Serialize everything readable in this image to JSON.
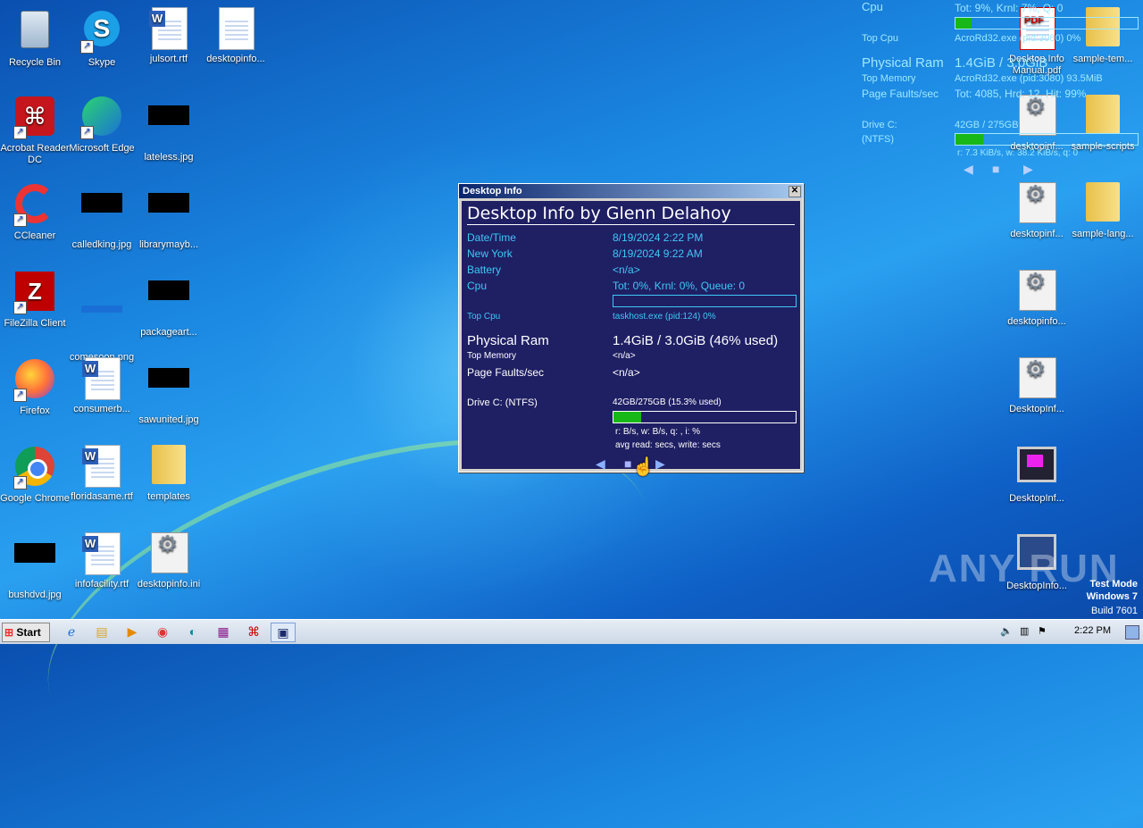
{
  "desktop_icons": [
    {
      "label": "Recycle Bin",
      "kind": "bin"
    },
    {
      "label": "Skype",
      "kind": "skype"
    },
    {
      "label": "julsort.rtf",
      "kind": "word"
    },
    {
      "label": "desktopinfo...",
      "kind": "doc"
    },
    {
      "label": "Acrobat Reader DC",
      "kind": "acrobat"
    },
    {
      "label": "Microsoft Edge",
      "kind": "edge"
    },
    {
      "label": "lateless.jpg",
      "kind": "blackimg"
    },
    {
      "label": "CCleaner",
      "kind": "ccleaner"
    },
    {
      "label": "calledking.jpg",
      "kind": "blackimg"
    },
    {
      "label": "librarymayb...",
      "kind": "blackimg"
    },
    {
      "label": "FileZilla Client",
      "kind": "filezilla"
    },
    {
      "label": "comesoon.png",
      "kind": "blueimg"
    },
    {
      "label": "packageart...",
      "kind": "blackimg"
    },
    {
      "label": "Firefox",
      "kind": "firefox"
    },
    {
      "label": "consumerb...",
      "kind": "word"
    },
    {
      "label": "sawunited.jpg",
      "kind": "blackimg"
    },
    {
      "label": "Google Chrome",
      "kind": "chrome"
    },
    {
      "label": "floridasame.rtf",
      "kind": "word"
    },
    {
      "label": "templates",
      "kind": "folder"
    },
    {
      "label": "bushdvd.jpg",
      "kind": "blackimg"
    },
    {
      "label": "infofacility.rtf",
      "kind": "word"
    },
    {
      "label": "desktopinfo.ini",
      "kind": "gear"
    },
    {
      "label": "Desktop Info Manual.pdf",
      "kind": "pdf"
    },
    {
      "label": "sample-tem...",
      "kind": "folder"
    },
    {
      "label": "desktopinf...",
      "kind": "gear"
    },
    {
      "label": "sample-scripts",
      "kind": "folder"
    },
    {
      "label": "desktopinf...",
      "kind": "gear"
    },
    {
      "label": "sample-lang...",
      "kind": "folder"
    },
    {
      "label": "desktopinfo...",
      "kind": "gear"
    },
    {
      "label": "DesktopInf...",
      "kind": "gear"
    },
    {
      "label": "DesktopInf...",
      "kind": "monitor"
    },
    {
      "label": "DesktopInfo...",
      "kind": "monitor2"
    }
  ],
  "dialog": {
    "title": "Desktop Info",
    "close": "✕",
    "heading": "Desktop Info by Glenn Delahoy",
    "rows": {
      "datetime": {
        "label": "Date/Time",
        "value": "8/19/2024 2:22 PM"
      },
      "newyork": {
        "label": "New York",
        "value": "8/19/2024 9:22 AM"
      },
      "battery": {
        "label": "Battery",
        "value": "<n/a>"
      },
      "cpu": {
        "label": "Cpu",
        "value": "Tot:  0%, Krnl:  0%, Queue: 0"
      },
      "topcpu": {
        "label": "Top Cpu",
        "value": "taskhost.exe (pid:124) 0%"
      },
      "ram": {
        "label": "Physical Ram",
        "value": "1.4GiB / 3.0GiB (46% used)"
      },
      "topmem": {
        "label": "Top Memory",
        "value": "<n/a>"
      },
      "faults": {
        "label": "Page Faults/sec",
        "value": "<n/a>"
      },
      "drive": {
        "label": "Drive C: (NTFS)",
        "value": "42GB/275GB (15.3% used)"
      },
      "io": {
        "value": "r: B/s, w: B/s, q: , i: %"
      },
      "avg": {
        "value": "avg read: secs, write: secs"
      }
    },
    "cpu_fraction": 0.0,
    "drive_fraction": 0.153,
    "nav": {
      "prev": "◀",
      "stop": "■",
      "next": "▶"
    }
  },
  "overlay": {
    "cpu_label": "Cpu",
    "cpu_value": "Tot:  9%, Krnl:  7%, Q: 0",
    "topcpu_label": "Top Cpu",
    "topcpu_value": "AcroRd32.exe (pid:3080) 0%",
    "ram_label": "Physical Ram",
    "ram_value": "1.4GiB / 3.0GiB",
    "topmem_label": "Top Memory",
    "topmem_value": "AcroRd32.exe (pid:3080) 93.5MiB",
    "faults_label": "Page Faults/sec",
    "faults_value": "Tot: 4085, Hrd: 12, Hit: 99%",
    "drive_label": "Drive C:",
    "drive_fs": "(NTFS)",
    "drive_value": "42GB / 275GB",
    "io_value": "r: 7.3 KiB/s, w: 38.2 KiB/s, q: 0",
    "cpu_fraction": 0.09,
    "drive_fraction": 0.153,
    "nav": {
      "prev": "◀",
      "stop": "■",
      "next": "▶"
    }
  },
  "taskbar": {
    "start": "Start",
    "clock": "2:22 PM",
    "apps": [
      "ie",
      "explorer",
      "media",
      "chrome",
      "edge",
      "winrar",
      "acrobat",
      "desktopinfo"
    ]
  },
  "watermark": {
    "line1": "Test Mode",
    "line2": "Windows 7",
    "line3": "Build 7601",
    "anyrun": "ANY RUN"
  },
  "colors": {
    "dialog_bg": "#1f1f64",
    "text_cyan": "#3dc9f5",
    "bar_green": "#18b818"
  }
}
